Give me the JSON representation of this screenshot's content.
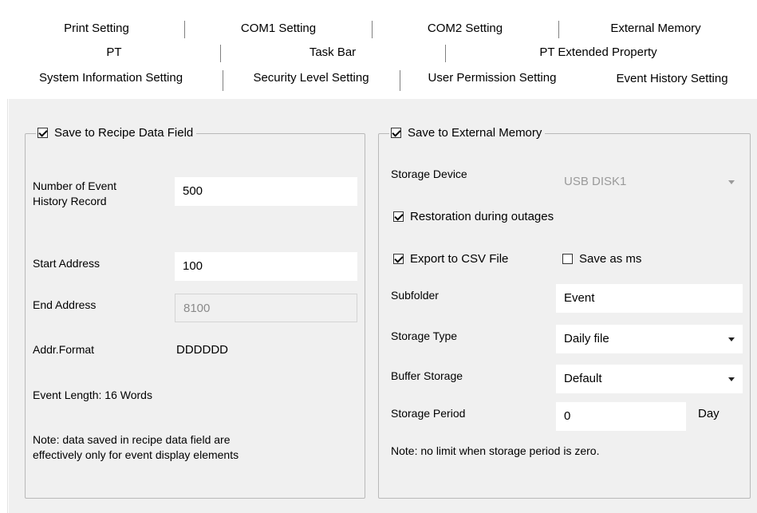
{
  "tabs": {
    "row1": [
      "Print Setting",
      "COM1 Setting",
      "COM2 Setting",
      "External Memory"
    ],
    "row2": [
      "PT",
      "Task Bar",
      "PT Extended Property"
    ],
    "row3": [
      "System Information Setting",
      "Security Level Setting",
      "User Permission Setting",
      "Event History Setting"
    ],
    "active": "Event History Setting"
  },
  "left_group": {
    "legend": "Save to Recipe Data Field",
    "legend_checked": true,
    "num_records_label": "Number of Event\nHistory Record",
    "num_records_value": "500",
    "start_address_label": "Start Address",
    "start_address_value": "100",
    "end_address_label": "End Address",
    "end_address_value": "8100",
    "addr_format_label": "Addr.Format",
    "addr_format_value": "DDDDDD",
    "event_length": "Event Length: 16 Words",
    "note": "Note: data saved in recipe data field are\neffectively only for event display elements"
  },
  "right_group": {
    "legend": "Save to External Memory",
    "legend_checked": true,
    "storage_device_label": "Storage Device",
    "storage_device_value": "USB DISK1",
    "restoration_label": "Restoration during outages",
    "restoration_checked": true,
    "export_csv_label": "Export to CSV File",
    "export_csv_checked": true,
    "save_ms_label": "Save as ms",
    "save_ms_checked": false,
    "subfolder_label": "Subfolder",
    "subfolder_value": "Event",
    "storage_type_label": "Storage Type",
    "storage_type_value": "Daily file",
    "buffer_storage_label": "Buffer Storage",
    "buffer_storage_value": "Default",
    "storage_period_label": "Storage Period",
    "storage_period_value": "0",
    "storage_period_unit": "Day",
    "note": "Note: no limit when storage period is zero."
  }
}
